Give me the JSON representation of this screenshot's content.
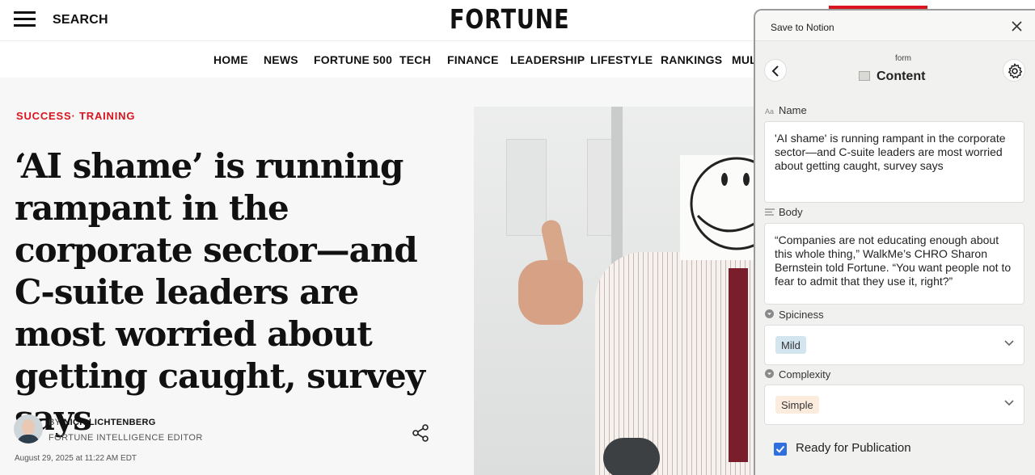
{
  "header": {
    "search_label": "SEARCH",
    "logo": "FORTUNE"
  },
  "nav": {
    "items": [
      "HOME",
      "NEWS",
      "FORTUNE 500",
      "TECH",
      "FINANCE",
      "LEADERSHIP",
      "LIFESTYLE",
      "RANKINGS",
      "MULT"
    ]
  },
  "article": {
    "kicker_section": "SUCCESS",
    "kicker_sep": "·",
    "kicker_topic": "TRAINING",
    "headline": "‘AI shame’ is running rampant in the corporate sector—and C-suite leaders are most worried about getting caught, survey says",
    "byline_prefix": "BY ",
    "author": "NICK LICHTENBERG",
    "author_title": "FORTUNE INTELLIGENCE EDITOR",
    "date": "August 29, 2025 at 11:22 AM EDT"
  },
  "notion": {
    "panel_title": "Save to Notion",
    "form_label": "form",
    "form_title": "Content",
    "name_label": "Name",
    "name_icon": "Aa",
    "name_value": "'AI shame' is running rampant in the corporate sector—and C-suite leaders are most worried about getting caught, survey says",
    "body_label": "Body",
    "body_value": "“Companies are not educating enough about this whole thing,” WalkMe’s CHRO Sharon Bernstein told Fortune. “You want people not to fear to admit that they use it, right?”",
    "spiciness_label": "Spiciness",
    "spiciness_value": "Mild",
    "complexity_label": "Complexity",
    "complexity_value": "Simple",
    "checkbox_label": "Ready for Publication",
    "checkbox_checked": true
  },
  "colors": {
    "brand_red": "#d9141e",
    "checkbox_blue": "#2f6fde",
    "tag_mild_bg": "#d3e5ef",
    "tag_simple_bg": "#fbecdd"
  }
}
